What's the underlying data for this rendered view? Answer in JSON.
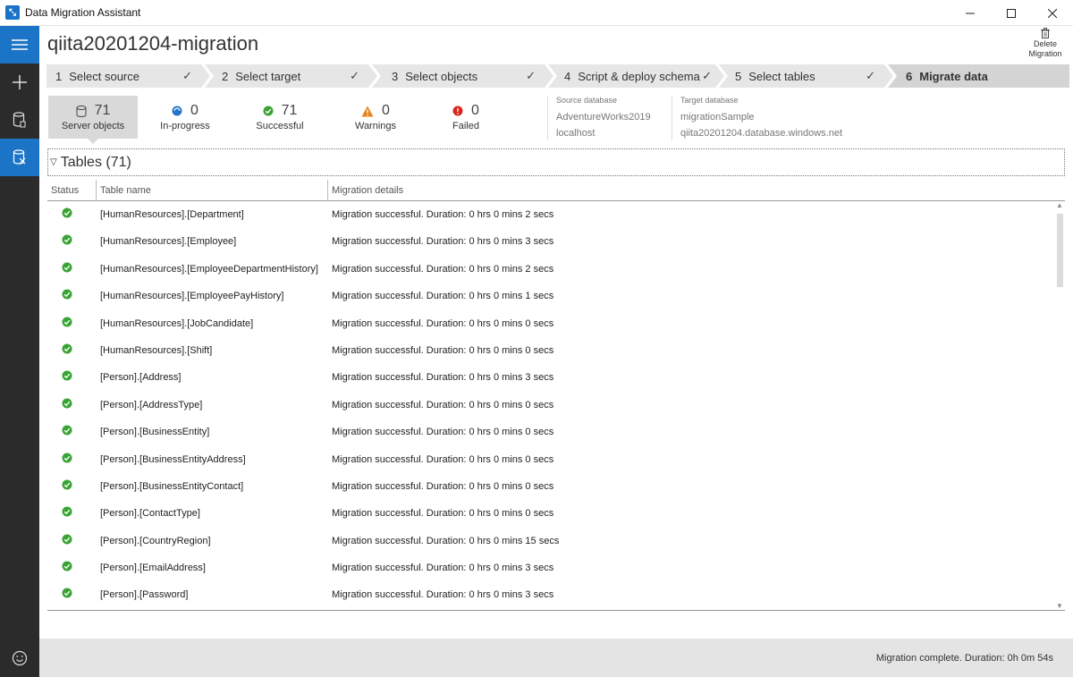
{
  "window": {
    "title": "Data Migration Assistant",
    "controls": [
      "minimize-icon",
      "maximize-icon",
      "close-icon"
    ]
  },
  "project": {
    "title": "qiita20201204-migration",
    "delete_label_line1": "Delete",
    "delete_label_line2": "Migration"
  },
  "steps": [
    {
      "num": "1",
      "label": "Select source",
      "done": true
    },
    {
      "num": "2",
      "label": "Select target",
      "done": true
    },
    {
      "num": "3",
      "label": "Select objects",
      "done": true
    },
    {
      "num": "4",
      "label": "Script & deploy schema",
      "done": true
    },
    {
      "num": "5",
      "label": "Select tables",
      "done": true
    },
    {
      "num": "6",
      "label": "Migrate data",
      "done": false
    }
  ],
  "summary": {
    "server_objects": {
      "value": "71",
      "label": "Server objects"
    },
    "in_progress": {
      "value": "0",
      "label": "In-progress"
    },
    "successful": {
      "value": "71",
      "label": "Successful"
    },
    "warnings": {
      "value": "0",
      "label": "Warnings"
    },
    "failed": {
      "value": "0",
      "label": "Failed"
    }
  },
  "source": {
    "caption": "Source database",
    "name": "AdventureWorks2019",
    "server": "localhost"
  },
  "target": {
    "caption": "Target database",
    "name": "migrationSample",
    "server": "qiita20201204.database.windows.net"
  },
  "group": {
    "title": "Tables (71)"
  },
  "columns": {
    "status": "Status",
    "table_name": "Table name",
    "details": "Migration details"
  },
  "rows": [
    {
      "name": "[HumanResources].[Department]",
      "detail": "Migration successful. Duration: 0 hrs 0 mins 2 secs"
    },
    {
      "name": "[HumanResources].[Employee]",
      "detail": "Migration successful. Duration: 0 hrs 0 mins 3 secs"
    },
    {
      "name": "[HumanResources].[EmployeeDepartmentHistory]",
      "detail": "Migration successful. Duration: 0 hrs 0 mins 2 secs"
    },
    {
      "name": "[HumanResources].[EmployeePayHistory]",
      "detail": "Migration successful. Duration: 0 hrs 0 mins 1 secs"
    },
    {
      "name": "[HumanResources].[JobCandidate]",
      "detail": "Migration successful. Duration: 0 hrs 0 mins 0 secs"
    },
    {
      "name": "[HumanResources].[Shift]",
      "detail": "Migration successful. Duration: 0 hrs 0 mins 0 secs"
    },
    {
      "name": "[Person].[Address]",
      "detail": "Migration successful. Duration: 0 hrs 0 mins 3 secs"
    },
    {
      "name": "[Person].[AddressType]",
      "detail": "Migration successful. Duration: 0 hrs 0 mins 0 secs"
    },
    {
      "name": "[Person].[BusinessEntity]",
      "detail": "Migration successful. Duration: 0 hrs 0 mins 0 secs"
    },
    {
      "name": "[Person].[BusinessEntityAddress]",
      "detail": "Migration successful. Duration: 0 hrs 0 mins 0 secs"
    },
    {
      "name": "[Person].[BusinessEntityContact]",
      "detail": "Migration successful. Duration: 0 hrs 0 mins 0 secs"
    },
    {
      "name": "[Person].[ContactType]",
      "detail": "Migration successful. Duration: 0 hrs 0 mins 0 secs"
    },
    {
      "name": "[Person].[CountryRegion]",
      "detail": "Migration successful. Duration: 0 hrs 0 mins 15 secs"
    },
    {
      "name": "[Person].[EmailAddress]",
      "detail": "Migration successful. Duration: 0 hrs 0 mins 3 secs"
    },
    {
      "name": "[Person].[Password]",
      "detail": "Migration successful. Duration: 0 hrs 0 mins 3 secs"
    }
  ],
  "status_bar": {
    "message": "Migration complete. Duration:  0h 0m 54s"
  },
  "colors": {
    "accent": "#1b74c5",
    "rail": "#2b2b2b",
    "success": "#3aa335",
    "warning": "#e8821c",
    "error": "#d9261c",
    "info": "#2773c9"
  }
}
